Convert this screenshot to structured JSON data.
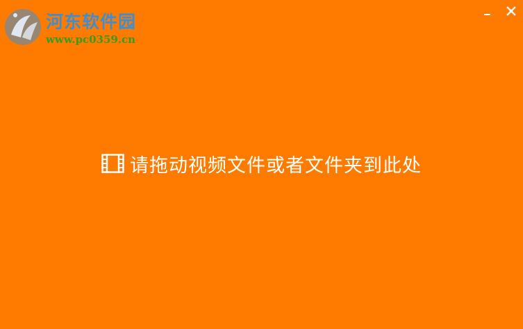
{
  "watermark": {
    "title": "河东软件园",
    "url": "www.pc0359.cn"
  },
  "window_controls": {
    "minimize_icon": "minimize-icon",
    "close_icon": "close-icon"
  },
  "drop_zone": {
    "icon": "film-icon",
    "message": "请拖动视频文件或者文件夹到此处"
  },
  "colors": {
    "background": "#ff7b00",
    "text": "#ffffff",
    "watermark_title": "#3f8fd0",
    "watermark_url": "#3a9a1e"
  }
}
